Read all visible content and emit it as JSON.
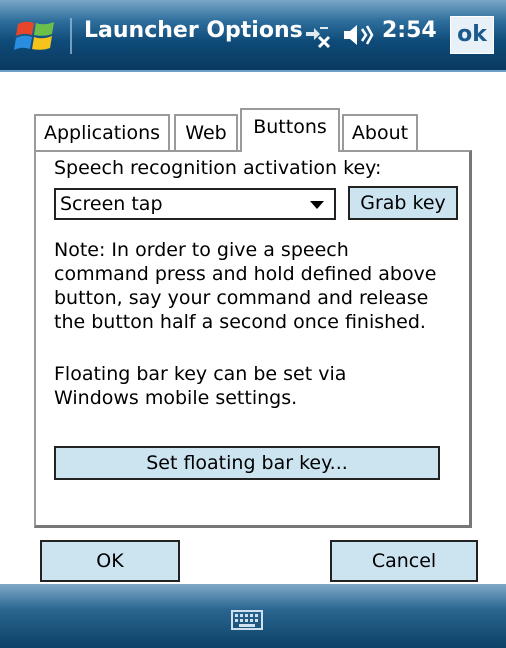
{
  "titlebar": {
    "title": "Launcher Options",
    "time": "2:54",
    "ok_label": "ok",
    "icons": [
      "windows-start-icon",
      "network-icon",
      "volume-icon"
    ]
  },
  "tabs": [
    {
      "label": "Applications",
      "active": false
    },
    {
      "label": "Web",
      "active": false
    },
    {
      "label": "Buttons",
      "active": true
    },
    {
      "label": "About",
      "active": false
    }
  ],
  "panel": {
    "activation_label": "Speech recognition activation key:",
    "combo_value": "Screen tap",
    "grab_key_label": "Grab key",
    "note_lines": [
      "Note: In order to give a speech",
      "command press and hold defined above",
      "button, say your command and release",
      "the button half a second once finished."
    ],
    "floating_lines": [
      "Floating bar key can be set via",
      "Windows mobile settings."
    ],
    "set_floating_label": "Set floating bar key..."
  },
  "footer": {
    "ok_label": "OK",
    "cancel_label": "Cancel"
  },
  "bottombar": {
    "icon": "keyboard-icon"
  }
}
